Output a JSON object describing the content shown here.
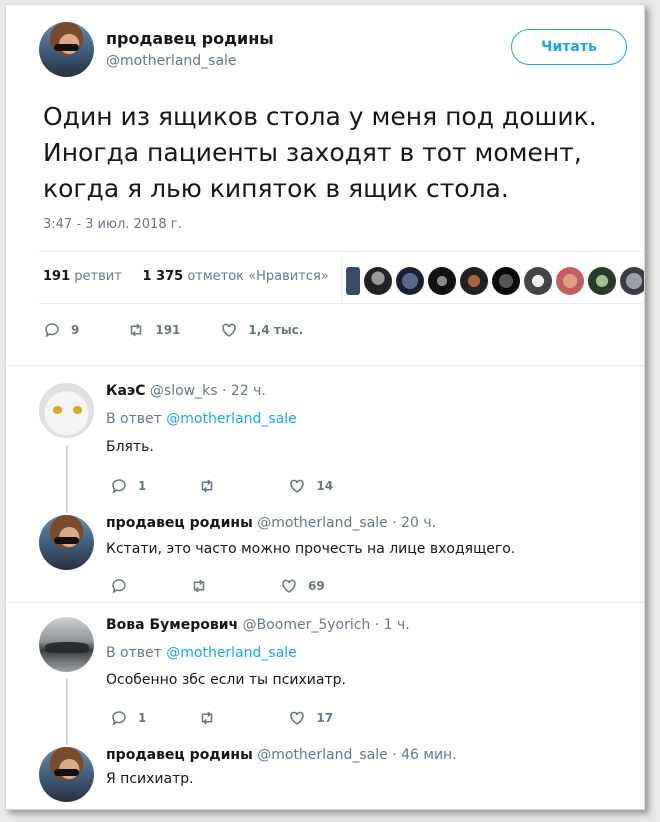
{
  "main_tweet": {
    "name": "продавец родины",
    "handle": "@motherland_sale",
    "follow_label": "Читать",
    "text": "Один из ящиков стола у меня под дошик. Иногда пациенты заходят в тот момент, когда я лью кипяток в ящик стола.",
    "timestamp": "3:47 - 3 июл. 2018 г.",
    "retweets_count": "191",
    "retweets_label": "ретвит",
    "likes_count": "1 375",
    "likes_label": "отметок «Нравится»",
    "actions": {
      "replies": "9",
      "retweets": "191",
      "likes": "1,4 тыс."
    }
  },
  "replies": [
    {
      "name": "КаэС",
      "handle": "@slow_ks",
      "time": "· 22 ч.",
      "reply_prefix": "В ответ",
      "reply_mention": "@motherland_sale",
      "text": "Блять.",
      "actions": {
        "replies": "1",
        "retweets": "",
        "likes": "14"
      }
    },
    {
      "name": "продавец родины",
      "handle": "@motherland_sale",
      "time": "· 20 ч.",
      "text": "Кстати, это часто можно прочесть на лице входящего.",
      "actions": {
        "replies": "",
        "retweets": "",
        "likes": "69"
      }
    },
    {
      "name": "Вова Бумерович",
      "handle": "@Boomer_5yorich",
      "time": "· 1 ч.",
      "reply_prefix": "В ответ",
      "reply_mention": "@motherland_sale",
      "text": "Особенно збс если ты психиатр.",
      "actions": {
        "replies": "1",
        "retweets": "",
        "likes": "17"
      }
    },
    {
      "name": "продавец родины",
      "handle": "@motherland_sale",
      "time": "· 46 мин.",
      "text": "Я психиатр."
    }
  ],
  "colors": {
    "accent": "#1da1f2",
    "secondary_text": "#657786",
    "divider": "#e6ecf0"
  },
  "icons": [
    "reply-icon",
    "retweet-icon",
    "like-icon"
  ]
}
